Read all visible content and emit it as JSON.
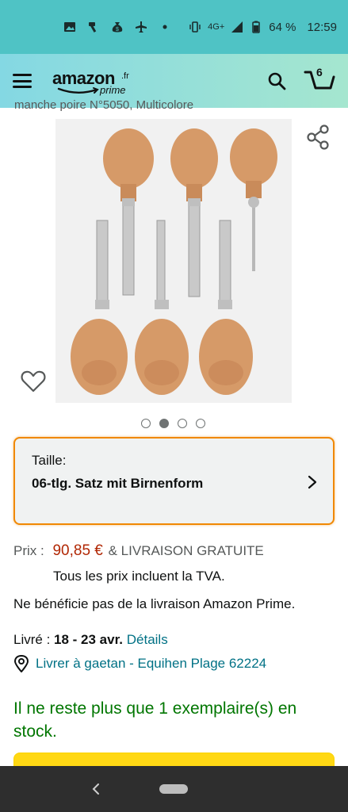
{
  "status_bar": {
    "battery": "64 %",
    "time": "12:59",
    "network": "4G+",
    "icons": [
      "image-icon",
      "hammer-icon",
      "money-bag-icon",
      "plane-icon",
      "dot-icon",
      "vibrate-icon",
      "signal-icon",
      "battery-icon"
    ]
  },
  "header": {
    "logo_text": "amazon",
    "logo_tld": ".fr",
    "logo_prime": "prime",
    "cart_count": "6",
    "brand_color": "#f08804"
  },
  "product": {
    "title_cut": "manche poire N°5050, Multicolore",
    "image_count": 4,
    "active_image": 2
  },
  "size_selector": {
    "label": "Taille:",
    "value": "06-tlg. Satz mit Birnenform"
  },
  "price": {
    "label": "Prix :",
    "value": "90,85 €",
    "shipping": "& LIVRAISON GRATUITE",
    "vat_note": "Tous les prix incluent la TVA.",
    "color": "#b12704"
  },
  "prime_note": "Ne bénéficie pas de la livraison Amazon Prime.",
  "delivery": {
    "prefix": "Livré :",
    "dates": "18 - 23 avr.",
    "details_link": "Détails",
    "location_link": "Livrer à gaetan - Equihen Plage 62224"
  },
  "stock_note": "Il ne reste plus que 1 exemplaire(s) en stock."
}
